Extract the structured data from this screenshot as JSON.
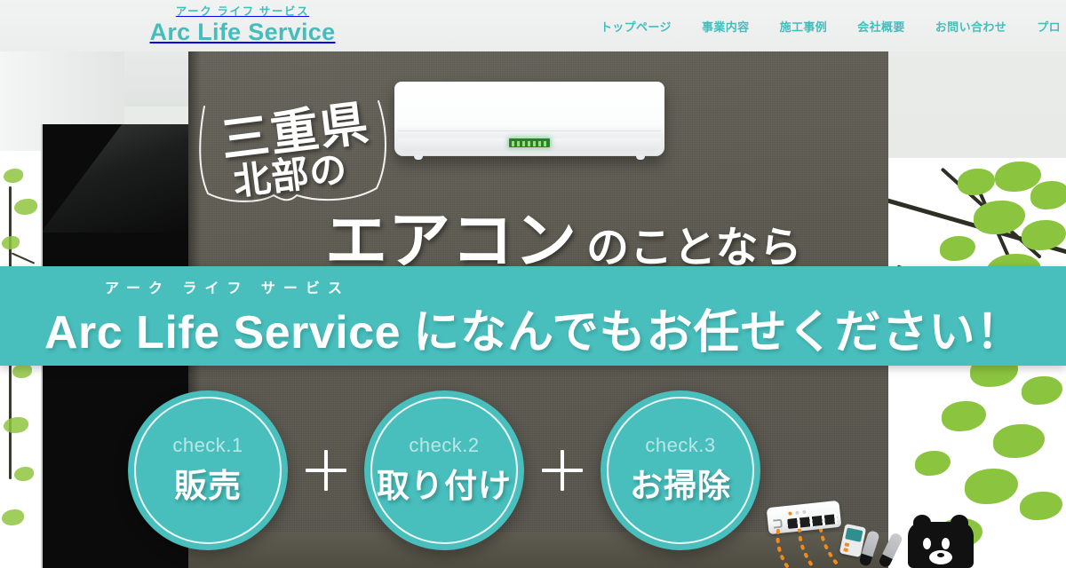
{
  "header": {
    "logo": {
      "kana": "アーク ライフ サービス",
      "name": "Arc Life Service"
    },
    "nav": [
      {
        "label": "トップページ",
        "name": "nav-top-page"
      },
      {
        "label": "事業内容",
        "name": "nav-business"
      },
      {
        "label": "施工事例",
        "name": "nav-works"
      },
      {
        "label": "会社概要",
        "name": "nav-company"
      },
      {
        "label": "お問い合わせ",
        "name": "nav-contact"
      },
      {
        "label": "プロ",
        "name": "nav-pro-truncated"
      }
    ]
  },
  "hero": {
    "catch_line_1": "三重県",
    "catch_line_2": "北部の",
    "headline_big": "エアコン",
    "headline_small": "のことなら",
    "band": {
      "kana": "アーク ライフ サービス",
      "brand": "Arc Life Service",
      "tail": "になんでもお任せください！"
    },
    "checks": [
      {
        "ck": "check.1",
        "label": "販売"
      },
      {
        "ck": "check.2",
        "label": "取り付け"
      },
      {
        "ck": "check.3",
        "label": "お掃除"
      }
    ],
    "separator": "+"
  },
  "colors": {
    "brand_teal": "#48bfbd",
    "header_bg": "#eceeed",
    "wall_dark": "#5b594f",
    "text_white": "#ffffff",
    "foliage_green": "#8bc53f"
  }
}
